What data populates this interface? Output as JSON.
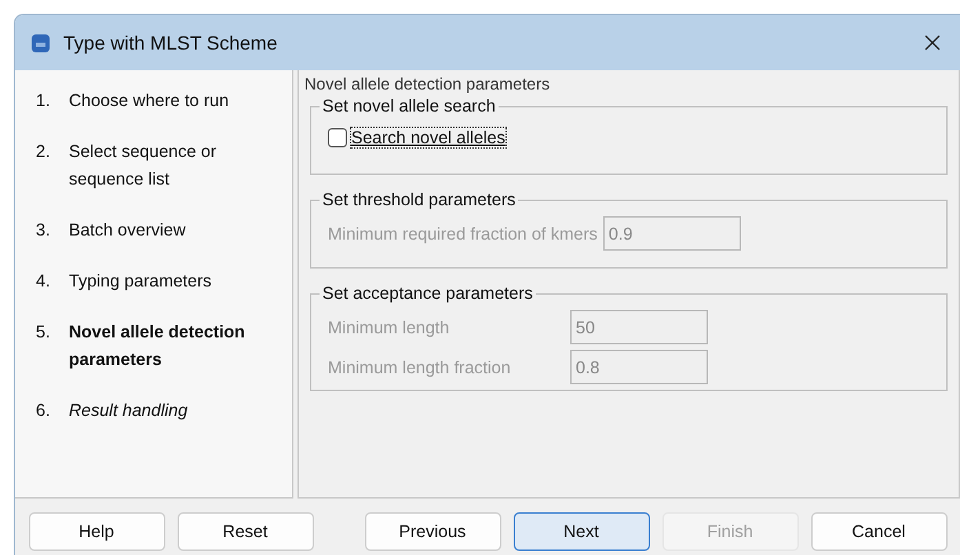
{
  "window": {
    "title": "Type with MLST Scheme"
  },
  "steps": [
    {
      "number": "1.",
      "label": "Choose where to run",
      "selected": false,
      "upcoming": false
    },
    {
      "number": "2.",
      "label": "Select sequence or sequence list",
      "selected": false,
      "upcoming": false
    },
    {
      "number": "3.",
      "label": "Batch overview",
      "selected": false,
      "upcoming": false
    },
    {
      "number": "4.",
      "label": "Typing parameters",
      "selected": false,
      "upcoming": false
    },
    {
      "number": "5.",
      "label": "Novel allele detection parameters",
      "selected": true,
      "upcoming": false
    },
    {
      "number": "6.",
      "label": "Result handling",
      "selected": false,
      "upcoming": true
    }
  ],
  "page_title": "Novel allele detection parameters",
  "groups": [
    {
      "title": "Set novel allele search",
      "kind": "checkbox",
      "label": "Search novel alleles",
      "checked": false,
      "focused": true
    },
    {
      "title": "Set threshold parameters",
      "kind": "fields",
      "disabled": true,
      "fields": [
        {
          "label": "Minimum required fraction of kmers",
          "value": "0.9"
        }
      ]
    },
    {
      "title": "Set acceptance parameters",
      "kind": "fields",
      "disabled": true,
      "fields": [
        {
          "label": "Minimum length",
          "value": "50"
        },
        {
          "label": "Minimum length fraction",
          "value": "0.8"
        }
      ]
    }
  ],
  "buttons": [
    {
      "label": "Help",
      "default": false,
      "disabled": false
    },
    {
      "label": "Reset",
      "default": false,
      "disabled": false
    },
    {
      "label": "Previous",
      "default": false,
      "disabled": false
    },
    {
      "label": "Next",
      "default": true,
      "disabled": false
    },
    {
      "label": "Finish",
      "default": false,
      "disabled": true
    },
    {
      "label": "Cancel",
      "default": false,
      "disabled": false
    }
  ]
}
